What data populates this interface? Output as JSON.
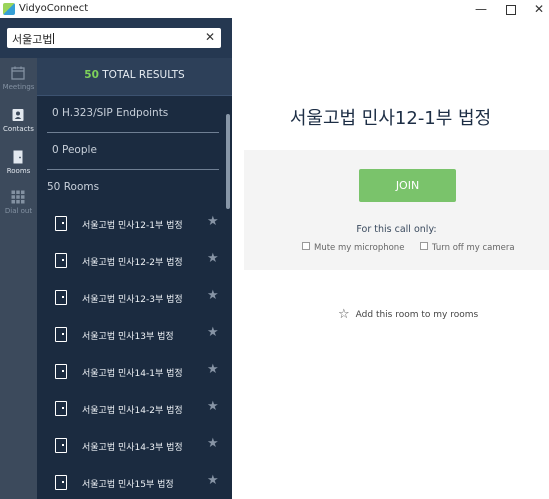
{
  "window": {
    "title": "VidyoConnect",
    "minimize": "—",
    "close": "✕"
  },
  "search": {
    "query": "서울고법",
    "clear": "✕"
  },
  "nav": [
    {
      "label": "Meetings",
      "icon": "calendar-icon"
    },
    {
      "label": "Contacts",
      "icon": "contacts-icon"
    },
    {
      "label": "Rooms",
      "icon": "door-icon"
    },
    {
      "label": "Dial out",
      "icon": "dialpad-icon"
    }
  ],
  "results": {
    "count": "50",
    "label": "TOTAL RESULTS",
    "categories": [
      "0 H.323/SIP Endpoints",
      "0 People",
      "50 Rooms"
    ],
    "rooms": [
      "서울고법 민사12-1부 법정",
      "서울고법 민사12-2부 법정",
      "서울고법 민사12-3부 법정",
      "서울고법 민사13부 법정",
      "서울고법 민사14-1부 법정",
      "서울고법 민사14-2부 법정",
      "서울고법 민사14-3부 법정",
      "서울고법 민사15부 법정"
    ]
  },
  "detail": {
    "title": "서울고법 민사12-1부 법정",
    "join": "JOIN",
    "call_only": "For this call only:",
    "mute_mic": "Mute my microphone",
    "camera_off": "Turn off my camera",
    "add_room": "Add this room to my rooms"
  },
  "colors": {
    "sidebar": "#253851",
    "list": "#1b2b40",
    "accent_green": "#7ac36b",
    "count_green": "#7ed25a"
  }
}
